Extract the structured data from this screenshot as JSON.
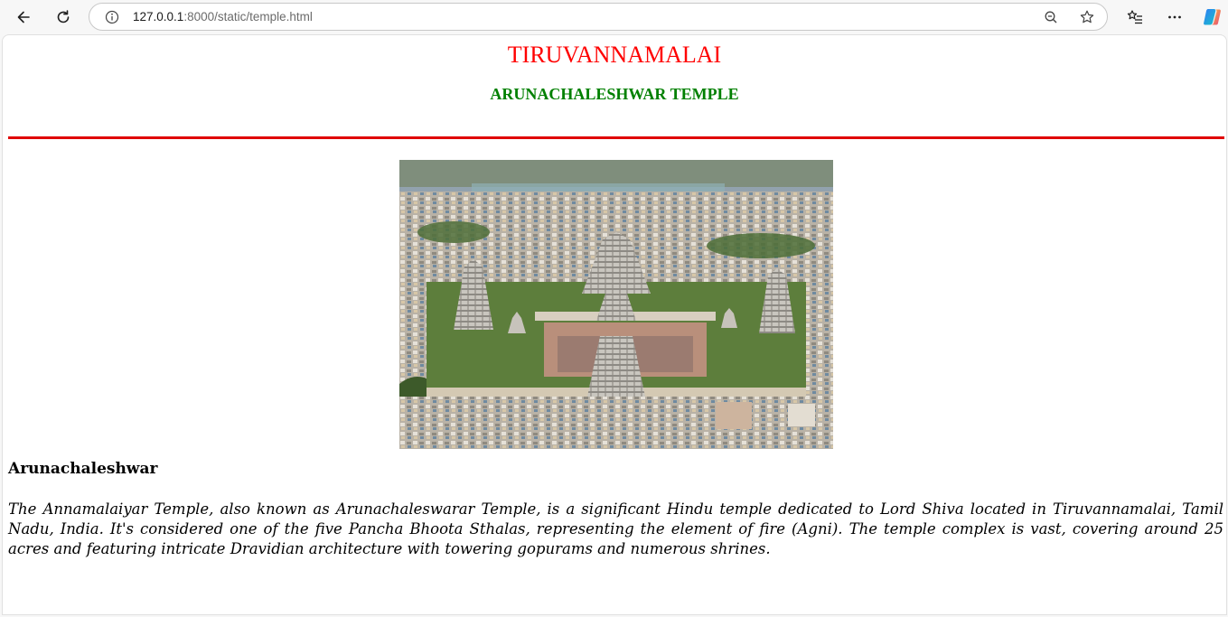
{
  "browser": {
    "url_host": "127.0.0.1",
    "url_rest": ":8000/static/temple.html",
    "icons": [
      "back-arrow-icon",
      "reload-icon",
      "info-icon",
      "zoom-out-icon",
      "favorite-star-icon",
      "favorites-list-icon",
      "more-menu-icon",
      "copilot-icon"
    ]
  },
  "page": {
    "title": "TIRUVANNAMALAI",
    "subtitle": "ARUNACHALESHWAR TEMPLE",
    "heading": "Arunachaleshwar",
    "paragraph": "The Annamalaiyar Temple, also known as Arunachaleswarar Temple, is a significant Hindu temple dedicated to Lord Shiva located in Tiruvannamalai, Tamil Nadu, India. It's considered one of the five Pancha Bhoota Sthalas, representing the element of fire (Agni). The temple complex is vast, covering around 25 acres and featuring intricate Dravidian architecture with towering gopurams and numerous shrines."
  },
  "colors": {
    "title": "#ff0000",
    "subtitle": "#008000",
    "rule": "#e00000"
  }
}
